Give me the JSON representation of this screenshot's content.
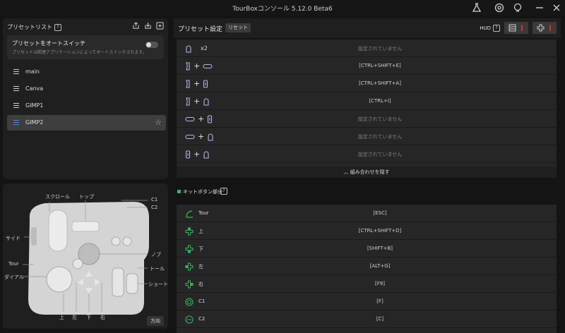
{
  "window": {
    "title": "TourBoxコンソール 5.12.0 Beta6"
  },
  "presets": {
    "header": "プリセットリスト",
    "autoswitch_title": "プリセットをオートスイッチ",
    "autoswitch_desc": "プリセットは関連アプリケーションによってオートスイッチされます。",
    "items": [
      {
        "label": "main"
      },
      {
        "label": "Canva"
      },
      {
        "label": "GIMP1"
      },
      {
        "label": "GIMP2"
      }
    ]
  },
  "device": {
    "labels": {
      "scroll": "スクロール",
      "top": "トップ",
      "c1": "C1",
      "c2": "C2",
      "side": "サイド",
      "knob": "ノブ",
      "tour": "Tour",
      "tall": "トール",
      "dial": "ダイアル",
      "short": "ショート",
      "up": "上",
      "left": "左",
      "down": "下",
      "right": "右"
    },
    "direction_button": "方向"
  },
  "settings": {
    "title": "プリセット設定",
    "reset": "リセット",
    "hud": "HUD"
  },
  "combos": [
    {
      "x2": "x2",
      "value": "設定されていません"
    },
    {
      "value": "[CTRL+SHIFT+E]"
    },
    {
      "value": "[CTRL+SHIFT+A]"
    },
    {
      "value": "[CTRL+I]"
    },
    {
      "value": "設定されていません"
    },
    {
      "value": "設定されていません"
    },
    {
      "value": "設定されていません"
    }
  ],
  "hide_combos": "組み合わせを隠す",
  "kit": {
    "label": "キットボタン部分",
    "rows": [
      {
        "name": "Tour",
        "value": "[ESC]"
      },
      {
        "name": "上",
        "value": "[CTRL+SHIFT+D]"
      },
      {
        "name": "下",
        "value": "[SHIFT+B]"
      },
      {
        "name": "左",
        "value": "[ALT+G]"
      },
      {
        "name": "右",
        "value": "[F9]"
      },
      {
        "name": "C1",
        "value": "[F]"
      },
      {
        "name": "C2",
        "value": "[C]"
      }
    ]
  }
}
